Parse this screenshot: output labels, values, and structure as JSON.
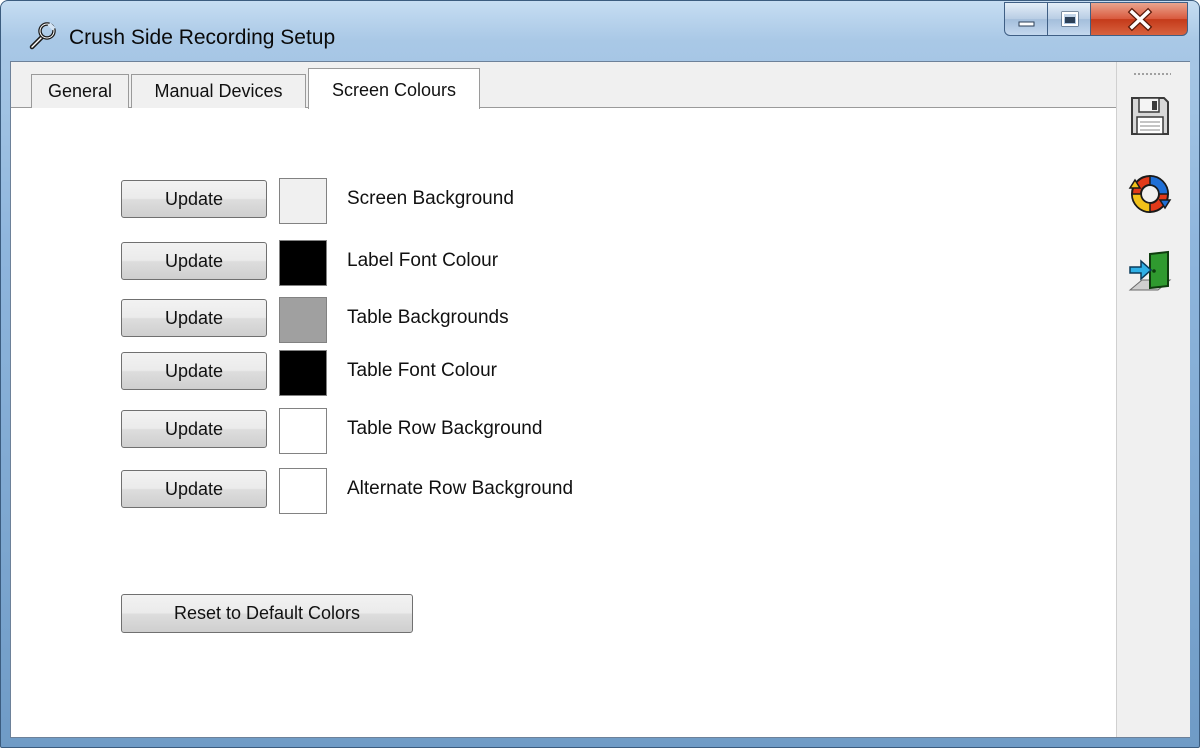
{
  "window": {
    "title": "Crush Side Recording Setup",
    "controls": {
      "minimize_icon": "minimize-icon",
      "maximize_icon": "maximize-icon",
      "close_icon": "close-icon"
    }
  },
  "tabs": [
    {
      "label": "General",
      "selected": false
    },
    {
      "label": "Manual Devices",
      "selected": false
    },
    {
      "label": "Screen Colours",
      "selected": true
    }
  ],
  "toolbar": {
    "icons": [
      "save-icon",
      "refresh-icon",
      "exit-icon"
    ]
  },
  "colour_settings": [
    {
      "button": "Update",
      "label": "Screen Background",
      "color": "#f0f0f0"
    },
    {
      "button": "Update",
      "label": "Label Font Colour",
      "color": "#000000"
    },
    {
      "button": "Update",
      "label": "Table Backgrounds",
      "color": "#a0a0a0"
    },
    {
      "button": "Update",
      "label": "Table Font Colour",
      "color": "#000000"
    },
    {
      "button": "Update",
      "label": "Table Row Background",
      "color": "#ffffff"
    },
    {
      "button": "Update",
      "label": "Alternate Row Background",
      "color": "#ffffff"
    }
  ],
  "reset_button": "Reset to Default Colors"
}
